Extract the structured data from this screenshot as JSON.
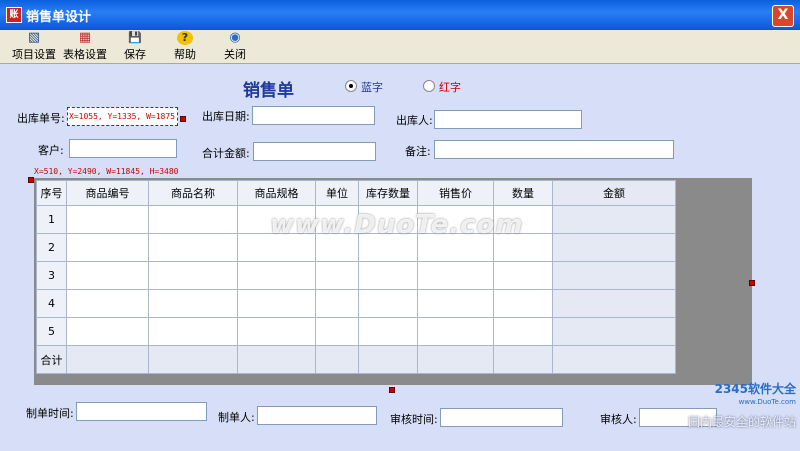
{
  "window": {
    "title": "销售单设计",
    "close": "X"
  },
  "toolbar": [
    {
      "label": "项目设置",
      "icon": "project-settings-icon",
      "glyph": "▧"
    },
    {
      "label": "表格设置",
      "icon": "table-settings-icon",
      "glyph": "▦"
    },
    {
      "label": "保存",
      "icon": "save-icon",
      "glyph": "💾"
    },
    {
      "label": "帮助",
      "icon": "help-icon",
      "glyph": "?"
    },
    {
      "label": "关闭",
      "icon": "close-icon",
      "glyph": "◉"
    }
  ],
  "form": {
    "title": "销售单",
    "radio_blue": "蓝字",
    "radio_red": "红字",
    "order_no_label": "出库单号:",
    "order_no_value": "X=1055, Y=1335, W=1875",
    "date_label": "出库日期:",
    "person_label": "出库人:",
    "customer_label": "客户:",
    "total_label": "合计金额:",
    "note_label": "备注:",
    "grid_coord": "X=510, Y=2490, W=11845, H=3480"
  },
  "grid": {
    "headers": [
      "序号",
      "商品编号",
      "商品名称",
      "商品规格",
      "单位",
      "库存数量",
      "销售价",
      "数量",
      "金额"
    ],
    "rows": [
      "1",
      "2",
      "3",
      "4",
      "5"
    ],
    "total_label": "合计"
  },
  "footer": {
    "make_time": "制单时间:",
    "maker": "制单人:",
    "review_time": "审核时间:",
    "reviewer": "审核人:"
  },
  "watermark": {
    "main": "www.DuoTe.com",
    "brand": "2345软件大全",
    "url": "www.DuoTe.com",
    "slogan": "国内最安全的软件站"
  }
}
